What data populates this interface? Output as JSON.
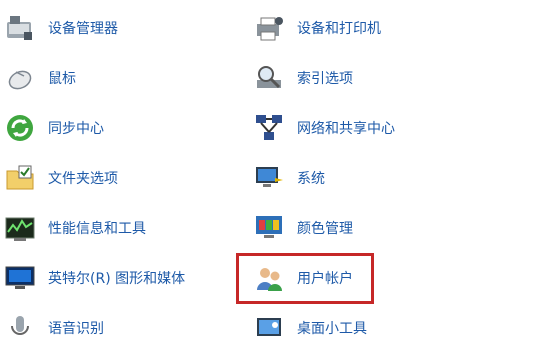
{
  "control_panel": {
    "left_items": [
      {
        "label": "设备管理器",
        "icon": "device-manager-icon"
      },
      {
        "label": "鼠标",
        "icon": "mouse-icon"
      },
      {
        "label": "同步中心",
        "icon": "sync-center-icon"
      },
      {
        "label": "文件夹选项",
        "icon": "folder-options-icon"
      },
      {
        "label": "性能信息和工具",
        "icon": "performance-icon"
      },
      {
        "label": "英特尔(R) 图形和媒体",
        "icon": "intel-graphics-icon"
      },
      {
        "label": "语音识别",
        "icon": "speech-recognition-icon"
      }
    ],
    "right_items": [
      {
        "label": "设备和打印机",
        "icon": "devices-printers-icon"
      },
      {
        "label": "索引选项",
        "icon": "indexing-options-icon"
      },
      {
        "label": "网络和共享中心",
        "icon": "network-sharing-icon"
      },
      {
        "label": "系统",
        "icon": "system-icon"
      },
      {
        "label": "颜色管理",
        "icon": "color-management-icon"
      },
      {
        "label": "用户帐户",
        "icon": "user-accounts-icon"
      },
      {
        "label": "桌面小工具",
        "icon": "desktop-gadgets-icon"
      }
    ],
    "highlight_color": "#c62828",
    "link_color": "#1e5aa8"
  }
}
